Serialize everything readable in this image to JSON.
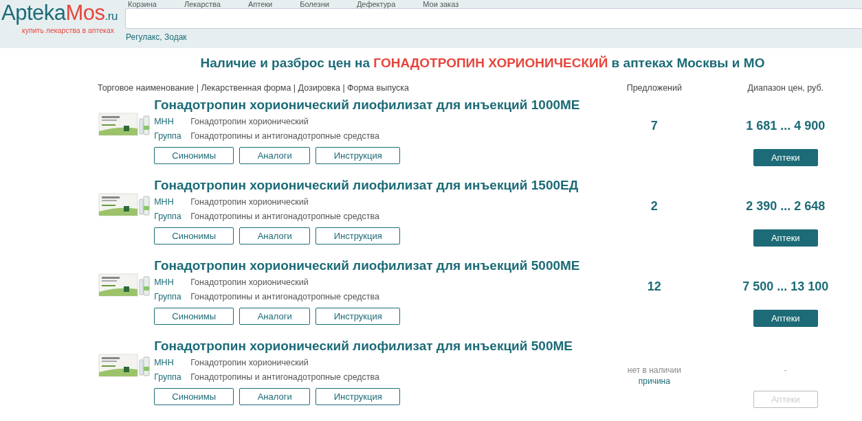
{
  "header": {
    "logo": {
      "main": "Apteka",
      "accent": "Mos",
      "suffix": ".ru",
      "tagline": "купить лекарства в аптеках"
    },
    "nav": [
      "Корзина",
      "Лекарства",
      "Аптеки",
      "Болезни",
      "Дефектура",
      "Мои заказ"
    ],
    "search": {
      "hint": "Регулакс, Зодак"
    }
  },
  "title": {
    "before": "Наличие и разброс цен на ",
    "highlight": "ГОНАДОТРОПИН ХОРИОНИЧЕСКИЙ",
    "after": " в аптеках Москвы и МО"
  },
  "columns": [
    "Торговое наименование | Лекарственная форма | Дозировка | Форма выпуска",
    "Предложений",
    "Диапазон цен, руб."
  ],
  "products": [
    {
      "name": "Гонадотропин хорионический лиофилизат для инъекций 1000МЕ",
      "inn_label": "МНН",
      "inn": "Гонадотропин хорионический",
      "group_label": "Группа",
      "group": "Гонадотропины и антигонадотропные средства",
      "buttons": [
        "Синонимы",
        "Аналоги",
        "Инструкция"
      ],
      "in_stock": true,
      "offers": "7",
      "price": "1 681 ... 4 900",
      "pharmacies": {
        "label": "Аптеки",
        "disabled": false
      }
    },
    {
      "name": "Гонадотропин хорионический лиофилизат для инъекций 1500ЕД",
      "inn_label": "МНН",
      "inn": "Гонадотропин хорионический",
      "group_label": "Группа",
      "group": "Гонадотропины и антигонадотропные средства",
      "buttons": [
        "Синонимы",
        "Аналоги",
        "Инструкция"
      ],
      "in_stock": true,
      "offers": "2",
      "price": "2 390 ... 2 648",
      "pharmacies": {
        "label": "Аптеки",
        "disabled": false
      }
    },
    {
      "name": "Гонадотропин хорионический лиофилизат для инъекций 5000МЕ",
      "inn_label": "МНН",
      "inn": "Гонадотропин хорионический",
      "group_label": "Группа",
      "group": "Гонадотропины и антигонадотропные средства",
      "buttons": [
        "Синонимы",
        "Аналоги",
        "Инструкция"
      ],
      "in_stock": true,
      "offers": "12",
      "price": "7 500 ... 13 100",
      "pharmacies": {
        "label": "Аптеки",
        "disabled": false
      }
    },
    {
      "name": "Гонадотропин хорионический лиофилизат для инъекций 500МЕ",
      "inn_label": "МНН",
      "inn": "Гонадотропин хорионический",
      "group_label": "Группа",
      "group": "Гонадотропины и антигонадотропные средства",
      "buttons": [
        "Синонимы",
        "Аналоги",
        "Инструкция"
      ],
      "in_stock": false,
      "offers": "нет в наличии",
      "reason": "причина",
      "price": "-",
      "pharmacies": {
        "label": "Аптеки",
        "disabled": true
      }
    }
  ]
}
